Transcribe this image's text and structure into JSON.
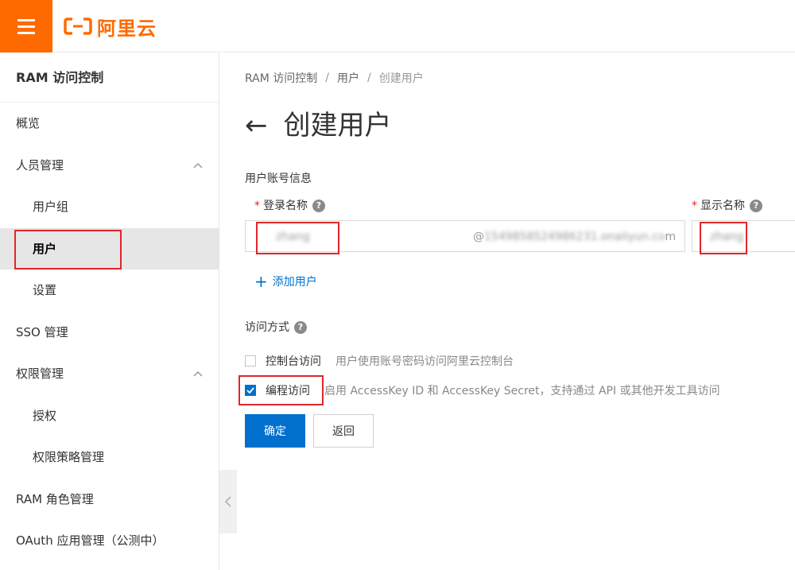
{
  "header": {
    "brand": "阿里云",
    "menu_icon": "hamburger-icon",
    "brand_color": "#ff6a00"
  },
  "sidebar": {
    "title": "RAM 访问控制",
    "items": [
      {
        "label": "概览"
      },
      {
        "label": "人员管理"
      },
      {
        "label": "用户组"
      },
      {
        "label": "用户"
      },
      {
        "label": "设置"
      },
      {
        "label": "SSO 管理"
      },
      {
        "label": "权限管理"
      },
      {
        "label": "授权"
      },
      {
        "label": "权限策略管理"
      },
      {
        "label": "RAM 角色管理"
      },
      {
        "label": "OAuth 应用管理（公测中）"
      }
    ],
    "collapse_icon": "chevron-left-icon"
  },
  "breadcrumb": {
    "root": "RAM 访问控制",
    "sep": "/",
    "parent": "用户",
    "current": "创建用户"
  },
  "page": {
    "back_icon": "arrow-left-icon",
    "back_glyph": "←",
    "title": "创建用户"
  },
  "form": {
    "section_account": "用户账号信息",
    "required_mark": "*",
    "help_glyph": "?",
    "login_name_label": "登录名称",
    "login_name_value": "zhang",
    "login_suffix_prefix": "@",
    "login_suffix_blurred": "1549858524986231.onaliyun.co",
    "login_suffix_tail": "m",
    "display_name_label": "显示名称",
    "display_name_value": "zhang",
    "add_user": "添加用户",
    "add_user_glyph": "+",
    "section_access": "访问方式",
    "console_access_label": "控制台访问",
    "console_access_desc": "用户使用账号密码访问阿里云控制台",
    "console_access_checked": false,
    "programmatic_access_label": "编程访问",
    "programmatic_access_desc": "启用 AccessKey ID 和 AccessKey Secret，支持通过 API 或其他开发工具访问",
    "programmatic_access_checked": true,
    "confirm_label": "确定",
    "back_label": "返回"
  },
  "colors": {
    "primary": "#0070cc",
    "highlight_border": "#e0262b",
    "active_nav_bg": "#e6e6e6"
  }
}
